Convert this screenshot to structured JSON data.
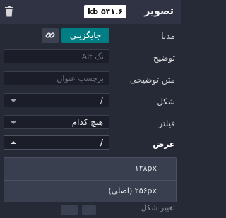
{
  "header": {
    "title": "تصویر",
    "size": "kb ۵۴۱.۶"
  },
  "media": {
    "label": "مدیا",
    "replace_label": "جایگزینی"
  },
  "description": {
    "label": "توضیح",
    "placeholder": "تگ Alt"
  },
  "tooltip": {
    "label": "متن توضیحی",
    "placeholder": "برچسب عنوان"
  },
  "shape": {
    "label": "شکل",
    "value": "/"
  },
  "filter": {
    "label": "فیلتر",
    "value": "هیچ کدام"
  },
  "width": {
    "label": "عرض",
    "value": "/",
    "options": [
      {
        "label": "۱۲۸px"
      },
      {
        "label": "۲۵۶px (اصلی)"
      }
    ]
  },
  "behind": {
    "label": "تغییر شکل"
  }
}
